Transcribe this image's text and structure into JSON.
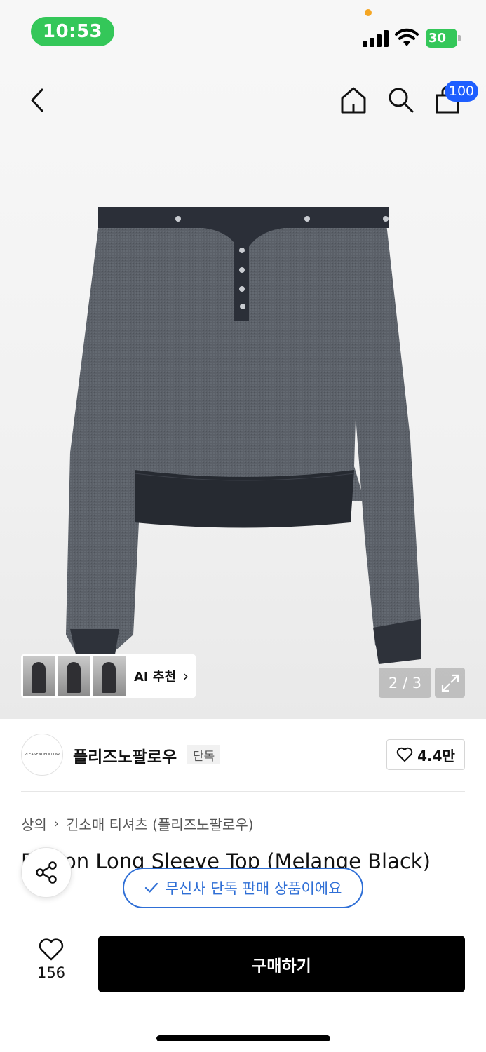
{
  "status_bar": {
    "time": "10:53",
    "battery": "30",
    "icons": [
      "signal-icon",
      "wifi-icon",
      "battery-icon"
    ]
  },
  "nav": {
    "icons": [
      "back-arrow-icon",
      "home-icon",
      "search-icon",
      "shopping-bag-icon"
    ],
    "cart_count": "100"
  },
  "gallery": {
    "ai_recommend_label": "AI 추천",
    "page_indicator": "2 / 3",
    "expand_icon": "expand-icon"
  },
  "brand": {
    "logo_text": "PLEASENOFOLLOW",
    "name": "플리즈노팔로우",
    "exclusive_tag": "단독",
    "like_count": "4.4만"
  },
  "breadcrumb": {
    "category": "상의",
    "subcategory": "긴소매 티셔츠 (플리즈노팔로우)"
  },
  "product": {
    "title": "Button Long Sleeve Top (Melange Black)"
  },
  "toast": {
    "text": "무신사 단독 판매 상품이에요"
  },
  "bottom": {
    "like_count": "156",
    "buy_label": "구매하기"
  },
  "colors": {
    "status_green": "#34c759",
    "badge_blue": "#1e5eff",
    "toast_blue": "#2f6fd6",
    "buy_black": "#000000"
  }
}
